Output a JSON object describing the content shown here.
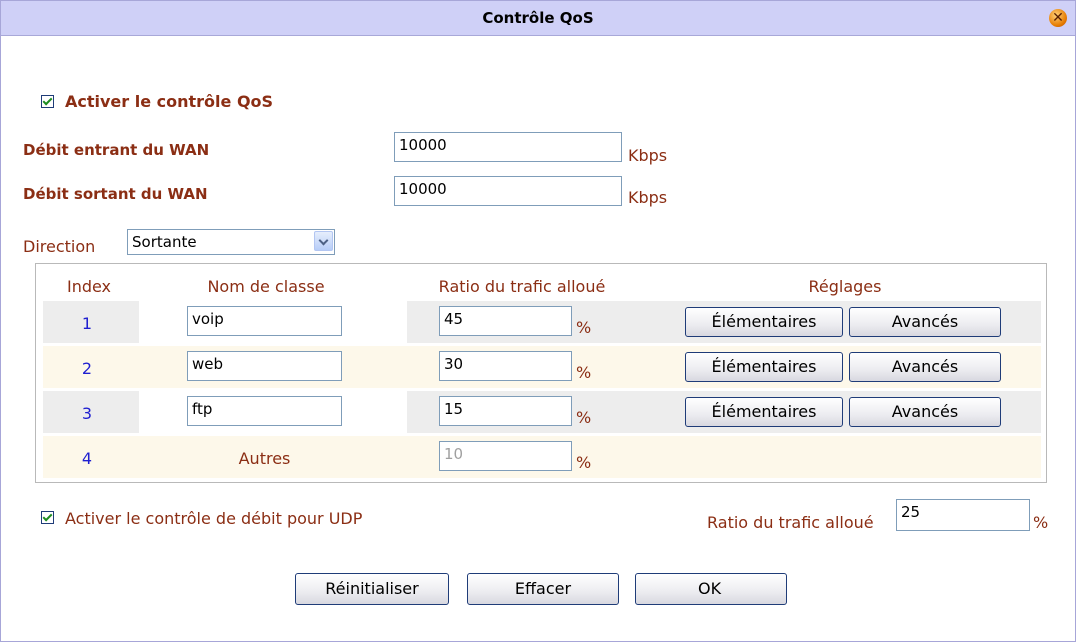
{
  "window": {
    "title": "Contrôle QoS",
    "close_icon": "close-icon"
  },
  "qos": {
    "enable_label": "Activer le contrôle QoS",
    "enable_checked": true,
    "wan_in_label": "Débit entrant du WAN",
    "wan_in_value": "10000",
    "wan_in_unit": "Kbps",
    "wan_out_label": "Débit sortant du WAN",
    "wan_out_value": "10000",
    "wan_out_unit": "Kbps"
  },
  "direction": {
    "label": "Direction",
    "selected": "Sortante"
  },
  "table": {
    "headers": [
      "Index",
      "Nom de classe",
      "Ratio du trafic alloué",
      "Réglages"
    ],
    "rows": [
      {
        "index": "1",
        "name": "voip",
        "ratio": "45",
        "unit": "%",
        "basic": "Élémentaires",
        "advanced": "Avancés"
      },
      {
        "index": "2",
        "name": "web",
        "ratio": "30",
        "unit": "%",
        "basic": "Élémentaires",
        "advanced": "Avancés"
      },
      {
        "index": "3",
        "name": "ftp",
        "ratio": "15",
        "unit": "%",
        "basic": "Élémentaires",
        "advanced": "Avancés"
      },
      {
        "index": "4",
        "name": "Autres",
        "ratio": "10",
        "unit": "%"
      }
    ]
  },
  "udp": {
    "enable_label": "Activer le contrôle de débit pour UDP",
    "enable_checked": true,
    "ratio_label": "Ratio du trafic alloué",
    "ratio_value": "25",
    "ratio_unit": "%"
  },
  "actions": {
    "reset": "Réinitialiser",
    "clear": "Effacer",
    "ok": "OK"
  },
  "colors": {
    "titlebar": "#cfd0f7",
    "label": "#8b2e14",
    "index": "#1f1fd0"
  }
}
